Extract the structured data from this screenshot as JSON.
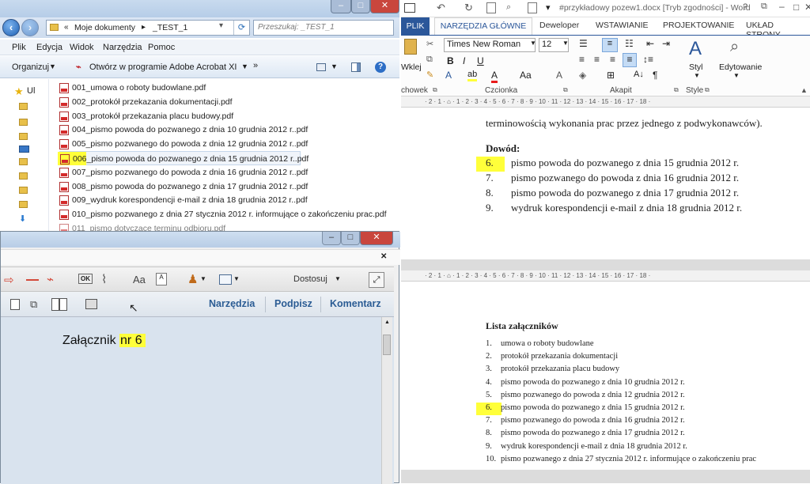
{
  "explorer": {
    "window_controls": [
      "–",
      "□",
      "✕"
    ],
    "address": {
      "prefix": "«",
      "crumb1": "Moje dokumenty",
      "separator": "▸",
      "crumb2": "_TEST_1"
    },
    "search_placeholder": "Przeszukaj: _TEST_1",
    "menu": [
      "Plik",
      "Edycja",
      "Widok",
      "Narzędzia",
      "Pomoc"
    ],
    "toolbar": {
      "organize": "Organizuj",
      "open_with": "Otwórz w programie Adobe Acrobat XI",
      "more": "»"
    },
    "nav_label": "Ul",
    "files": [
      "001_umowa o roboty budowlane.pdf",
      "002_protokół przekazania dokumentacji.pdf",
      "003_protokół przekazania placu budowy.pdf",
      "004_pismo powoda do pozwanego z dnia 10 grudnia 2012 r..pdf",
      "005_pismo pozwanego do powoda z dnia 12 grudnia 2012 r..pdf",
      "006_pismo powoda do pozwanego z dnia 15 grudnia 2012 r..pdf",
      "007_pismo pozwanego do powoda z dnia 16 grudnia 2012 r..pdf",
      "008_pismo powoda do pozwanego z dnia 17 grudnia 2012 r..pdf",
      "009_wydruk korespondencji e-mail z dnia 18 grudnia 2012 r..pdf",
      "010_pismo pozwanego z dnia 27 stycznia 2012 r. informujące o zakończeniu prac.pdf",
      "011_pismo dotyczące terminu odbioru.pdf"
    ],
    "selected_index": 5,
    "highlight_color": "#ffff3a"
  },
  "acrobat": {
    "window_controls": [
      "–",
      "□",
      "✕"
    ],
    "close_doc": "✕",
    "zoom_label": "Dostosuj",
    "tools": {
      "tools": "Narzędzia",
      "sign": "Podpisz",
      "comment": "Komentarz"
    },
    "page_text_prefix": "Załącznik ",
    "page_text_highlight": "nr 6"
  },
  "word": {
    "title": "#przykładowy pozew1.docx [Tryb zgodności] - Word",
    "window_controls": [
      "?",
      "–",
      "□",
      "✕"
    ],
    "tabs": {
      "file": "PLIK",
      "home": "NARZĘDZIA GŁÓWNE",
      "dev": "Deweloper",
      "insert": "WSTAWIANIE",
      "design": "PROJEKTOWANIE",
      "layout": "UKŁAD STRONY"
    },
    "ribbon": {
      "font_name": "Times New Roman",
      "font_size": "12",
      "paste": "Wklej",
      "clipboard": "chowek",
      "font_group": "Czcionka",
      "paragraph_group": "Akapit",
      "style_group": "Style",
      "style_btn": "Styl",
      "editing_btn": "Edytowanie"
    },
    "ruler_text": "· 2 · 1 · ⌂ · 1 · 2 · 3 · 4 · 5 · 6 · 7 · 8 · 9 · 10 · 11 · 12 · 13 · 14 · 15 · 16 · 17 · 18 ·",
    "page1": {
      "intro": "terminowością wykonania prac przez jednego z podwykonawców).",
      "heading": "Dowód:",
      "items": [
        {
          "num": "6.",
          "text": "pismo powoda do pozwanego z dnia 15 grudnia 2012 r.",
          "highlight": true
        },
        {
          "num": "7.",
          "text": "pismo pozwanego do powoda z dnia 16 grudnia 2012 r.",
          "highlight": false
        },
        {
          "num": "8.",
          "text": "pismo powoda do pozwanego z dnia 17 grudnia 2012 r.",
          "highlight": false
        },
        {
          "num": "9.",
          "text": "wydruk korespondencji e-mail z dnia 18 grudnia 2012 r.",
          "highlight": false
        }
      ]
    },
    "page2": {
      "heading": "Lista załączników",
      "items": [
        {
          "num": "1.",
          "text": "umowa o roboty budowlane",
          "highlight": false
        },
        {
          "num": "2.",
          "text": "protokół przekazania dokumentacji",
          "highlight": false
        },
        {
          "num": "3.",
          "text": "protokół przekazania placu budowy",
          "highlight": false
        },
        {
          "num": "4.",
          "text": "pismo powoda do pozwanego z dnia 10 grudnia 2012 r.",
          "highlight": false
        },
        {
          "num": "5.",
          "text": "pismo pozwanego do powoda z dnia 12 grudnia 2012 r.",
          "highlight": false
        },
        {
          "num": "6.",
          "text": "pismo powoda do pozwanego z dnia 15 grudnia 2012 r.",
          "highlight": true
        },
        {
          "num": "7.",
          "text": "pismo pozwanego do powoda z dnia 16 grudnia 2012 r.",
          "highlight": false
        },
        {
          "num": "8.",
          "text": "pismo powoda do pozwanego z dnia 17 grudnia 2012 r.",
          "highlight": false
        },
        {
          "num": "9.",
          "text": "wydruk korespondencji e-mail z dnia 18 grudnia 2012 r.",
          "highlight": false
        },
        {
          "num": "10.",
          "text": "pismo pozwanego z dnia 27 stycznia 2012 r. informujące o zakończeniu prac",
          "highlight": false
        }
      ]
    }
  }
}
